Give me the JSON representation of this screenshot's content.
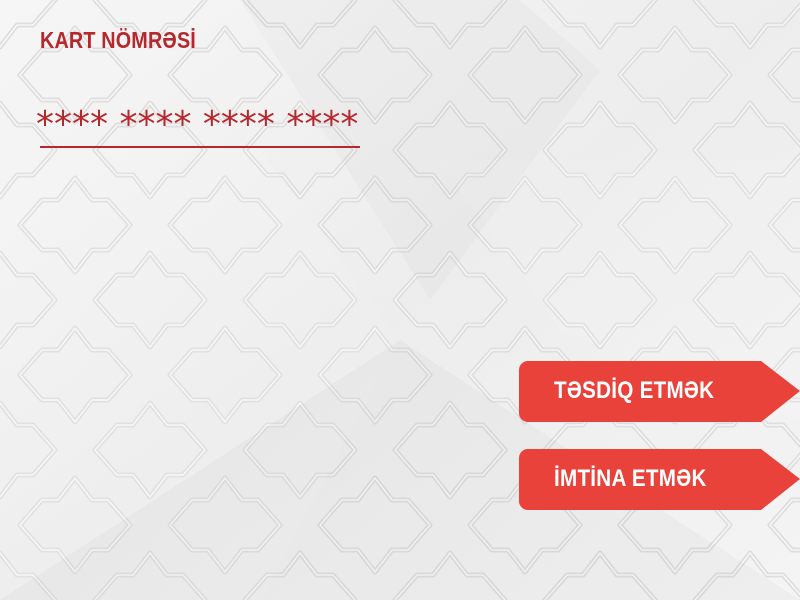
{
  "colors": {
    "accent": "#b7282e",
    "button": "#e8423a",
    "button_text": "#ffffff",
    "background": "#f3f3f3"
  },
  "card": {
    "title": "KART NÖMRƏSİ",
    "masked_value": "**** **** **** ****"
  },
  "actions": {
    "confirm_label": "TƏSDİQ ETMƏK",
    "cancel_label": "İMTİNA ETMƏK"
  }
}
